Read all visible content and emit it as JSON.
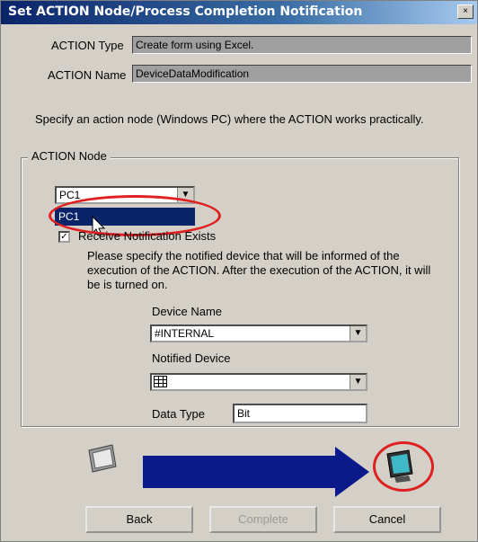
{
  "window": {
    "title": "Set ACTION Node/Process Completion Notification",
    "close_label": "×"
  },
  "fields": {
    "action_type_label": "ACTION Type",
    "action_type_value": "Create form using Excel.",
    "action_name_label": "ACTION Name",
    "action_name_value": "DeviceDataModification"
  },
  "instruction": "Specify an action node (Windows PC) where the ACTION works practically.",
  "action_node": {
    "legend": "ACTION Node",
    "combo_value": "PC1",
    "dropdown_item": "PC1",
    "checkbox_label": "Receive Notification Exists",
    "description": "Please specify the notified device that will be informed of the execution of the ACTION. After the execution of the ACTION, it will be is turned on.",
    "device_name_label": "Device Name",
    "device_name_value": "#INTERNAL",
    "notified_device_label": "Notified Device",
    "notified_device_value": "",
    "data_type_label": "Data Type",
    "data_type_value": "Bit"
  },
  "icons": {
    "source": "monitor-icon",
    "arrow": "arrow-right-icon",
    "target": "pc-display-icon",
    "device": "device-grid-icon"
  },
  "colors": {
    "arrow": "#0a1a8a",
    "highlight_ring": "#e02020",
    "selection": "#0a246a"
  },
  "buttons": {
    "back": "Back",
    "complete": "Complete",
    "cancel": "Cancel"
  }
}
